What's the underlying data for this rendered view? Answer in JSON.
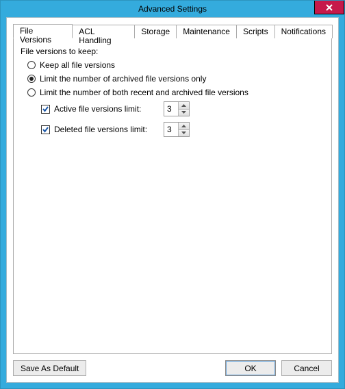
{
  "window": {
    "title": "Advanced Settings"
  },
  "tabs": [
    {
      "label": "File Versions"
    },
    {
      "label": "ACL Handling"
    },
    {
      "label": "Storage"
    },
    {
      "label": "Maintenance"
    },
    {
      "label": "Scripts"
    },
    {
      "label": "Notifications"
    }
  ],
  "panel": {
    "heading": "File versions to keep:",
    "radios": {
      "keep_all": "Keep all file versions",
      "limit_archived": "Limit the number of archived file versions only",
      "limit_both": "Limit the number of both recent and archived file versions"
    },
    "active_limit": {
      "label": "Active file versions limit:",
      "value": "3"
    },
    "deleted_limit": {
      "label": "Deleted file versions limit:",
      "value": "3"
    }
  },
  "buttons": {
    "save_default": "Save As Default",
    "ok": "OK",
    "cancel": "Cancel"
  }
}
